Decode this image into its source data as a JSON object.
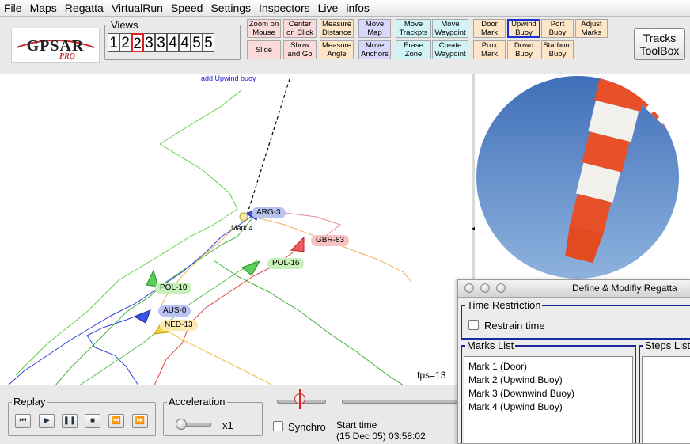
{
  "menubar": {
    "items": [
      "File",
      "Maps",
      "Regatta",
      "VirtualRun",
      "Speed",
      "Settings",
      "Inspectors",
      "Live",
      "infos"
    ]
  },
  "logo": {
    "main": "GPSAR",
    "sub": "PRO"
  },
  "views": {
    "title": "Views",
    "buttons": [
      "1",
      "2",
      "2",
      "3",
      "3",
      "4",
      "4",
      "5",
      "5"
    ],
    "active_index": 2
  },
  "tools": {
    "zoom_on_mouse": "Zoom on Mouse",
    "center_on_click": "Center on Click",
    "measure_distance": "Measure Distance",
    "move_map": "Move Map",
    "move_trackpts": "Move Trackpts",
    "move_waypoint": "Move Waypoint",
    "door_mark": "Door Mark",
    "upwind_buoy": "Upwind Buoy",
    "port_buoy": "Port Buoy",
    "adjust_marks": "Adjust Marks",
    "slide": "Slide",
    "show_and_go": "Show and Go",
    "measure_angle": "Measure Angle",
    "move_anchors": "Move Anchors",
    "erase_zone": "Erase Zone",
    "create_waypoint": "Create Waypoint",
    "prox_mark": "Prox Mark",
    "down_buoy": "Down Buoy",
    "starbord_buoy": "Starbord Buoy",
    "tracks_toolbox": "Tracks ToolBox"
  },
  "map": {
    "hint": "add Upwind buoy",
    "mark_label": "Mark 4",
    "fps": "fps=13",
    "boats": [
      {
        "name": "ARG-3",
        "color": "#b9c3f2"
      },
      {
        "name": "GBR-83",
        "color": "#f6c2c2"
      },
      {
        "name": "POL-16",
        "color": "#c8f0b9"
      },
      {
        "name": "POL-10",
        "color": "#c8f0b9"
      },
      {
        "name": "AUS-0",
        "color": "#b9c3f2"
      },
      {
        "name": "NED-13",
        "color": "#fbeab0"
      }
    ]
  },
  "replay": {
    "title": "Replay",
    "icons": [
      "step-back-icon",
      "play-icon",
      "pause-icon",
      "stop-icon",
      "rewind-icon",
      "fast-forward-icon"
    ]
  },
  "acceleration": {
    "title": "Acceleration",
    "value": "x1"
  },
  "synchro": {
    "label": "Synchro",
    "checked": false
  },
  "start_time": {
    "label": "Start time",
    "value": "(15 Dec 05) 03:58:02"
  },
  "dialog": {
    "title": "Define & Modifiy Regatta",
    "time_restriction": {
      "title": "Time Restriction",
      "checkbox_label": "Restrain time",
      "checked": false
    },
    "marks_list": {
      "title": "Marks List",
      "items": [
        "Mark 1 (Door)",
        "Mark 2 (Upwind Buoy)",
        "Mark 3 (Downwind Buoy)",
        "Mark 4 (Upwind Buoy)"
      ]
    },
    "steps_list": {
      "title": "Steps List"
    }
  }
}
